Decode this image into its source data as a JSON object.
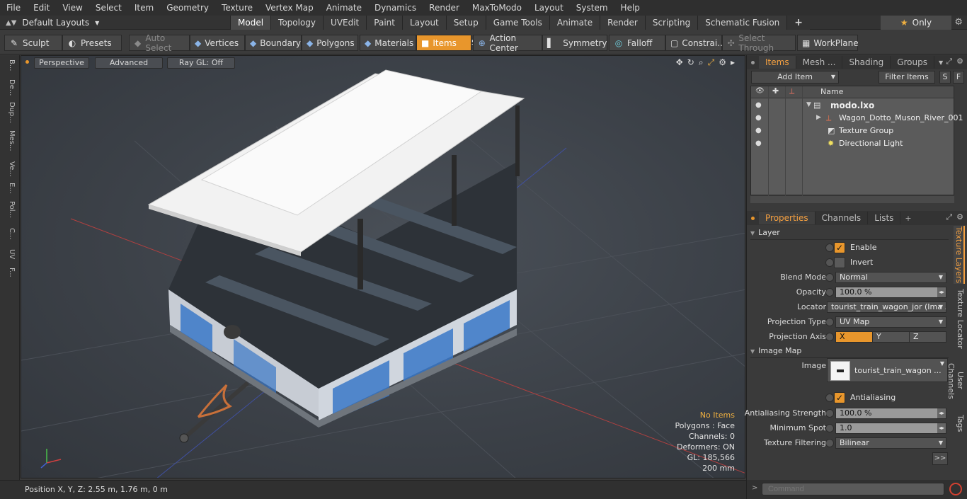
{
  "menu": [
    "File",
    "Edit",
    "View",
    "Select",
    "Item",
    "Geometry",
    "Texture",
    "Vertex Map",
    "Animate",
    "Dynamics",
    "Render",
    "MaxToModo",
    "Layout",
    "System",
    "Help"
  ],
  "layout": {
    "current": "Default Layouts"
  },
  "tabs": [
    {
      "label": "Model",
      "active": true
    },
    {
      "label": "Topology"
    },
    {
      "label": "UVEdit"
    },
    {
      "label": "Paint"
    },
    {
      "label": "Layout"
    },
    {
      "label": "Setup"
    },
    {
      "label": "Game Tools"
    },
    {
      "label": "Animate"
    },
    {
      "label": "Render"
    },
    {
      "label": "Scripting"
    },
    {
      "label": "Schematic Fusion"
    }
  ],
  "only_label": "Only",
  "toolbar": {
    "sculpt": "Sculpt",
    "presets": "Presets",
    "auto_select": "Auto Select",
    "vertices": "Vertices",
    "vertices_count": "1",
    "boundary": "Boundary",
    "polygons": "Polygons",
    "materials": "Materials",
    "items": "Items",
    "items_count": "5",
    "action_center": "Action Center",
    "symmetry": "Symmetry",
    "falloff": "Falloff",
    "constrain": "Constrai...",
    "select_through": "Select Through",
    "workplane": "WorkPlane"
  },
  "left_tabs": [
    "B...",
    "De...",
    "Dup...",
    "Mes...",
    "Ve...",
    "E...",
    "Pol...",
    "C...",
    "UV",
    "F..."
  ],
  "viewport": {
    "perspective": "Perspective",
    "advanced": "Advanced",
    "raygl": "Ray GL: Off",
    "info": {
      "no_items": "No Items",
      "polygons": "Polygons : Face",
      "channels": "Channels: 0",
      "deformers": "Deformers: ON",
      "gl": "GL: 185,566",
      "scale": "200 mm"
    }
  },
  "status": {
    "position": "Position X, Y, Z:   2.55 m, 1.76 m, 0 m"
  },
  "items_panel": {
    "tabs": [
      "Items",
      "Mesh ...",
      "Shading",
      "Groups"
    ],
    "add_item": "Add Item",
    "filter_items": "Filter Items",
    "s_btn": "S",
    "f_btn": "F",
    "name_header": "Name",
    "rows": [
      {
        "label": "modo.lxo"
      },
      {
        "label": "Wagon_Dotto_Muson_River_001"
      },
      {
        "label": "Texture Group"
      },
      {
        "label": "Directional Light"
      }
    ]
  },
  "props_panel": {
    "tabs": [
      "Properties",
      "Channels",
      "Lists"
    ],
    "layer_section": "Layer",
    "enable": "Enable",
    "invert": "Invert",
    "blend_mode_label": "Blend Mode",
    "blend_mode": "Normal",
    "opacity_label": "Opacity",
    "opacity": "100.0 %",
    "locator_label": "Locator",
    "locator": "tourist_train_wagon_jor (Ima ...",
    "proj_type_label": "Projection Type",
    "proj_type": "UV Map",
    "proj_axis_label": "Projection Axis",
    "axes": [
      "X",
      "Y",
      "Z"
    ],
    "image_map_section": "Image Map",
    "image_label": "Image",
    "image": "tourist_train_wagon ...",
    "antialiasing": "Antialiasing",
    "aa_strength_label": "Antialiasing Strength",
    "aa_strength": "100.0 %",
    "min_spot_label": "Minimum Spot",
    "min_spot": "1.0",
    "tex_filter_label": "Texture Filtering",
    "tex_filter": "Bilinear",
    "more": ">>",
    "side_tabs": [
      "Texture Layers",
      "Texture Locator",
      "User Channels",
      "Tags"
    ]
  },
  "command": {
    "placeholder": "Command"
  }
}
